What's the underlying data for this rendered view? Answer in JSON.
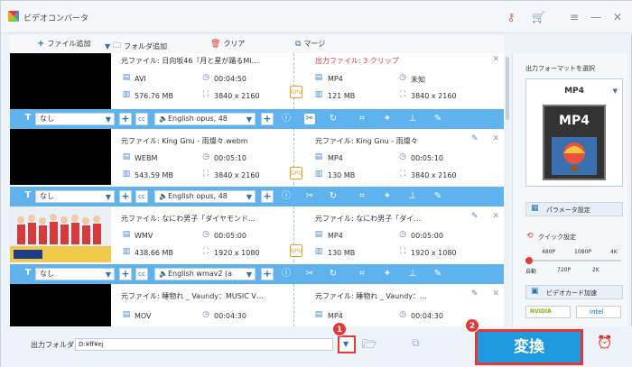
{
  "window": {
    "title": "ビデオコンバータ"
  },
  "toolbar": {
    "add_file": "ファイル追加",
    "add_folder": "フォルダ追加",
    "clear": "クリア",
    "merge": "マージ"
  },
  "items": [
    {
      "source_label": "元ファイル: 日向坂46『月と星が踊るMi…",
      "output_label": "出力ファイル: 3 クリップ",
      "src_format": "AVI",
      "src_duration": "00:04:50",
      "src_size": "576.76 MB",
      "src_resolution": "3840 x 2160",
      "out_format": "MP4",
      "out_duration": "未知",
      "out_size": "121 MB",
      "out_resolution": "3840 x 2160",
      "subtitle": "なし",
      "audio": "English opus, 48"
    },
    {
      "source_label": "元ファイル: King Gnu - 雨燦々.webm",
      "output_label": "元ファイル: King Gnu - 雨燦々",
      "src_format": "WEBM",
      "src_duration": "00:05:10",
      "src_size": "543.59 MB",
      "src_resolution": "3840 x 2160",
      "out_format": "MP4",
      "out_duration": "00:05:10",
      "out_size": "130 MB",
      "out_resolution": "3840 x 2160",
      "subtitle": "なし",
      "audio": "English opus, 48"
    },
    {
      "source_label": "元ファイル: なにわ男子「ダイヤモンド…",
      "output_label": "元ファイル: なにわ男子「ダイ…",
      "src_format": "WMV",
      "src_duration": "00:05:00",
      "src_size": "438.66 MB",
      "src_resolution": "1920 x 1080",
      "out_format": "MP4",
      "out_duration": "00:05:00",
      "out_size": "130 MB",
      "out_resolution": "1920 x 1080",
      "subtitle": "なし",
      "audio": "English wmav2 (a"
    },
    {
      "source_label": "元ファイル: 睡物れ _ Vaundy：MUSIC V…",
      "output_label": "元ファイル: 睡物れ _ Vaundy：…",
      "src_format": "MOV",
      "src_duration": "00:04:30",
      "out_format": "MP4",
      "out_duration": "00:04:30"
    }
  ],
  "gpu_label": "GPU",
  "right_panel": {
    "format_title": "出力フォーマットを選択",
    "selected_format": "MP4",
    "thumb_label": "MP4",
    "param_settings": "パラメータ設定",
    "quick_settings": "クイック設定",
    "quality_top": [
      "480P",
      "1080P",
      "4K"
    ],
    "quality_bottom": [
      "自動",
      "720P",
      "2K"
    ],
    "gpu_accel": "ビデオカード加速",
    "nvidia": "NVIDIA",
    "intel": "intel"
  },
  "bottom": {
    "output_folder_label": "出力フォルダ:",
    "output_folder_value": "D:¥ff¥ej",
    "convert": "変換",
    "badge1": "1",
    "badge2": "2"
  },
  "colors": {
    "accent": "#5eb3ef",
    "convert": "#1e9be0",
    "highlight": "#e53935"
  }
}
